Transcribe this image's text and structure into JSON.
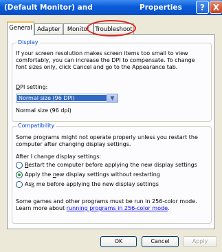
{
  "window": {
    "title_left": "(Default Monitor) and",
    "title_right": "Properties",
    "help_glyph": "?",
    "close_glyph": "X"
  },
  "tabs": [
    {
      "label": "General",
      "active": true
    },
    {
      "label": "Adapter",
      "active": false
    },
    {
      "label": "Monitor",
      "active": false
    },
    {
      "label": "Troubleshoot",
      "active": false
    }
  ],
  "annotation": {
    "highlighted_tab": "Troubleshoot",
    "color": "#e0211b"
  },
  "display": {
    "group_title": "Display",
    "description_lines": [
      "If your screen resolution makes screen items too small to view",
      "comfortably, you can increase the DPI to compensate.  To change",
      "font sizes only, click Cancel and go to the Appearance tab."
    ],
    "dpi_label_mnemonic": "D",
    "dpi_label_rest": "PI setting:",
    "dpi_value": "Normal size (96 DPI)",
    "dpi_status": "Normal size (96 dpi)"
  },
  "compatibility": {
    "group_title": "Compatibility",
    "description_lines": [
      "Some programs might not operate properly unless you restart the",
      "computer after changing display settings."
    ],
    "after_label": "After I change display settings:",
    "options": [
      {
        "pre": "",
        "mnemonic": "R",
        "post": "estart the computer before applying the new display settings",
        "checked": false
      },
      {
        "pre": "Apply the ",
        "mnemonic": "n",
        "post": "ew display settings without restarting",
        "checked": true
      },
      {
        "pre": "As",
        "mnemonic": "k",
        "post": " me before applying the new display settings",
        "checked": false
      }
    ],
    "note_line1": "Some games and other programs must be run in 256-color mode.",
    "note_line2_prefix": "Learn more about ",
    "note_link": "running programs in 256-color mode",
    "note_line2_suffix": "."
  },
  "buttons": {
    "ok": "OK",
    "cancel": "Cancel",
    "apply": "Apply"
  }
}
